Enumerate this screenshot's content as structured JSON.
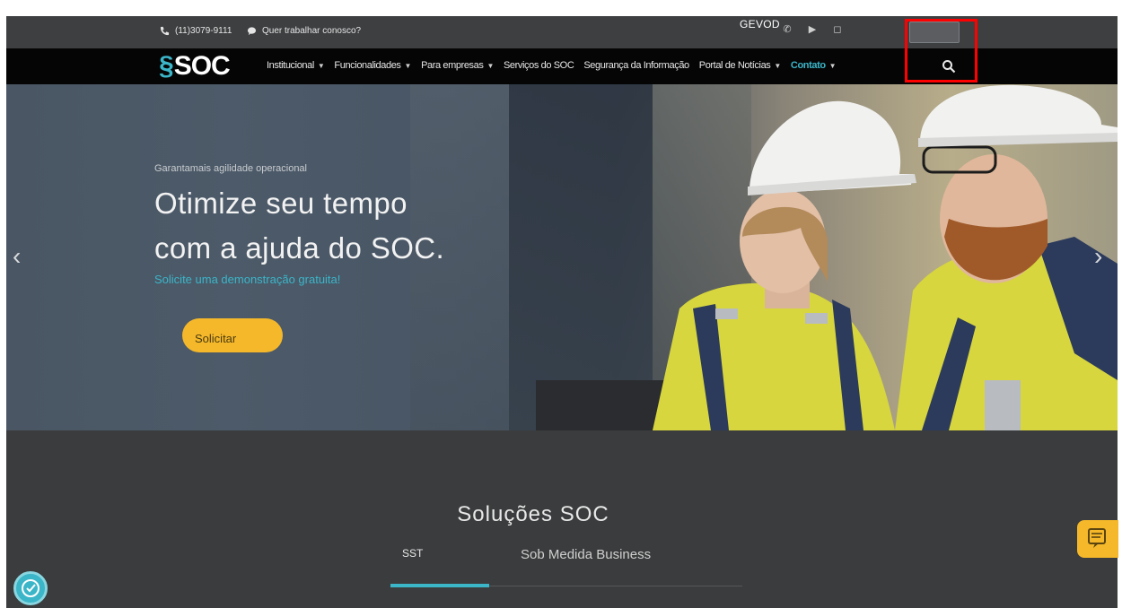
{
  "topbar": {
    "phone": "(11)3079-9111",
    "whatsapp": "Quer trabalhar conosco?",
    "overlay_text": "GEVOD",
    "icons": [
      "whatsapp-icon",
      "youtube-icon",
      "instagram-icon"
    ]
  },
  "nav": {
    "logo": "SOC",
    "items": [
      {
        "label": "Institucional",
        "dropdown": true
      },
      {
        "label": "Funcionalidades",
        "dropdown": true
      },
      {
        "label": "Para empresas",
        "dropdown": true
      },
      {
        "label": "Serviços do SOC",
        "dropdown": false
      },
      {
        "label": "Segurança da Informação",
        "dropdown": false
      },
      {
        "label": "Portal de Notícias",
        "dropdown": true
      },
      {
        "label": "Contato",
        "dropdown": true
      }
    ]
  },
  "hero": {
    "kicker": "Garantamais agilidade operacional",
    "headline_line1": "Otimize seu tempo",
    "headline_line2": "com a ajuda do SOC.",
    "subtitle": "Solicite uma demonstração gratuita!",
    "cta": "Solicitar"
  },
  "solutions": {
    "title": "Soluções SOC",
    "tabs": [
      "SST",
      "Sob Medida Business"
    ]
  },
  "colors": {
    "accent": "#3bb5c8",
    "cta": "#f5b82a",
    "nav_bg": "#050505",
    "page_bg": "#3b3c3d"
  }
}
